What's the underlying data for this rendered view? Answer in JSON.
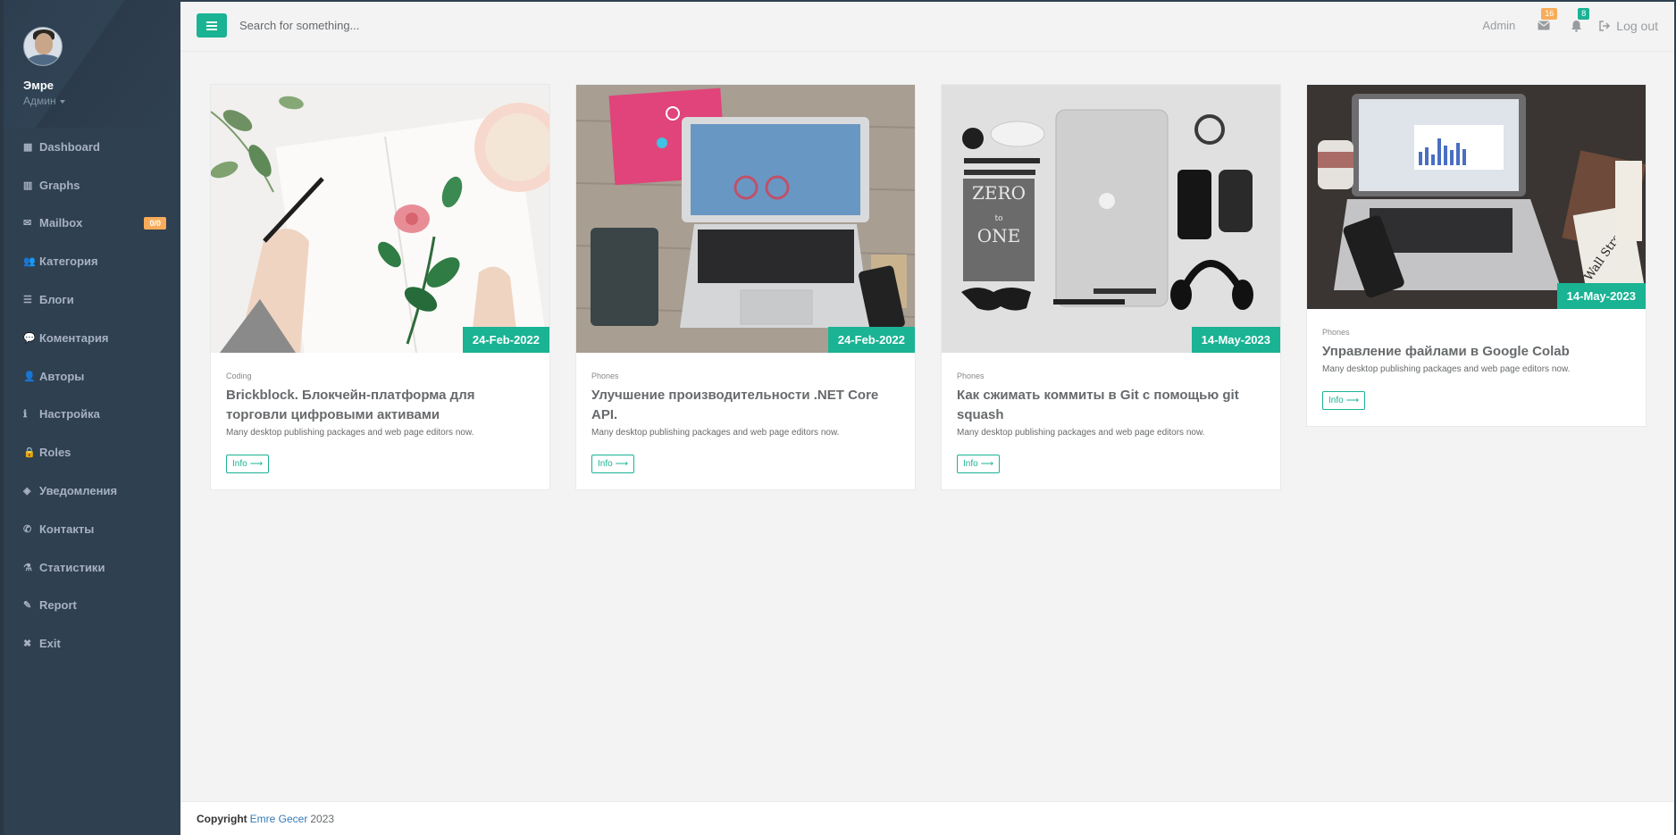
{
  "sidebar": {
    "profile": {
      "name": "Эмре",
      "role": "Админ"
    },
    "items": [
      {
        "icon": "dashboard-icon",
        "glyph": "▦",
        "label": "Dashboard"
      },
      {
        "icon": "bar-chart-icon",
        "glyph": "▥",
        "label": "Graphs"
      },
      {
        "icon": "envelope-icon",
        "glyph": "✉",
        "label": "Mailbox",
        "badge": "0/0"
      },
      {
        "icon": "users-icon",
        "glyph": "👥",
        "label": "Категория"
      },
      {
        "icon": "list-icon",
        "glyph": "☰",
        "label": "Блоги"
      },
      {
        "icon": "comment-icon",
        "glyph": "💬",
        "label": "Коментария"
      },
      {
        "icon": "user-icon",
        "glyph": "👤",
        "label": "Авторы"
      },
      {
        "icon": "info-icon",
        "glyph": "ℹ",
        "label": "Настройка"
      },
      {
        "icon": "lock-icon",
        "glyph": "🔒",
        "label": "Roles"
      },
      {
        "icon": "diamond-icon",
        "glyph": "◈",
        "label": "Уведомления"
      },
      {
        "icon": "phone-icon",
        "glyph": "✆",
        "label": "Контакты"
      },
      {
        "icon": "flask-icon",
        "glyph": "⚗",
        "label": "Статистики"
      },
      {
        "icon": "pencil-icon",
        "glyph": "✎",
        "label": "Report"
      },
      {
        "icon": "close-icon",
        "glyph": "✖",
        "label": "Exit"
      }
    ]
  },
  "topbar": {
    "search_placeholder": "Search for something...",
    "user": "Admin",
    "messages_count": "16",
    "alerts_count": "8",
    "logout_label": "Log out"
  },
  "cards": [
    {
      "image": "notebook-flower-drawing",
      "date": "24-Feb-2022",
      "category": "Coding",
      "title": "Brickblock. Блокчейн-платформа для торговли цифровыми активами",
      "description": "Many desktop publishing packages and web page editors now.",
      "button": "Info"
    },
    {
      "image": "laptop-on-wood-desk",
      "date": "24-Feb-2022",
      "category": "Phones",
      "title": "Улучшение производительности .NET Core API.",
      "description": "Many desktop publishing packages and web page editors now.",
      "button": "Info"
    },
    {
      "image": "grayscale-gadgets-flatlay",
      "date": "14-May-2023",
      "category": "Phones",
      "title": "Как сжимать коммиты в Git с помощью git squash",
      "description": "Many desktop publishing packages and web page editors now.",
      "button": "Info"
    },
    {
      "image": "laptop-dark-desk",
      "date": "14-May-2023",
      "category": "Phones",
      "title": "Управление файлами в Google Colab",
      "description": "Many desktop publishing packages and web page editors now.",
      "button": "Info"
    }
  ],
  "footer": {
    "copyright_label": "Copyright",
    "author": "Emre Gecer",
    "year": "2023"
  },
  "colors": {
    "sidebar": "#2f4050",
    "accent": "#1ab394",
    "badge": "#f8ac59",
    "background": "#f3f3f4"
  }
}
